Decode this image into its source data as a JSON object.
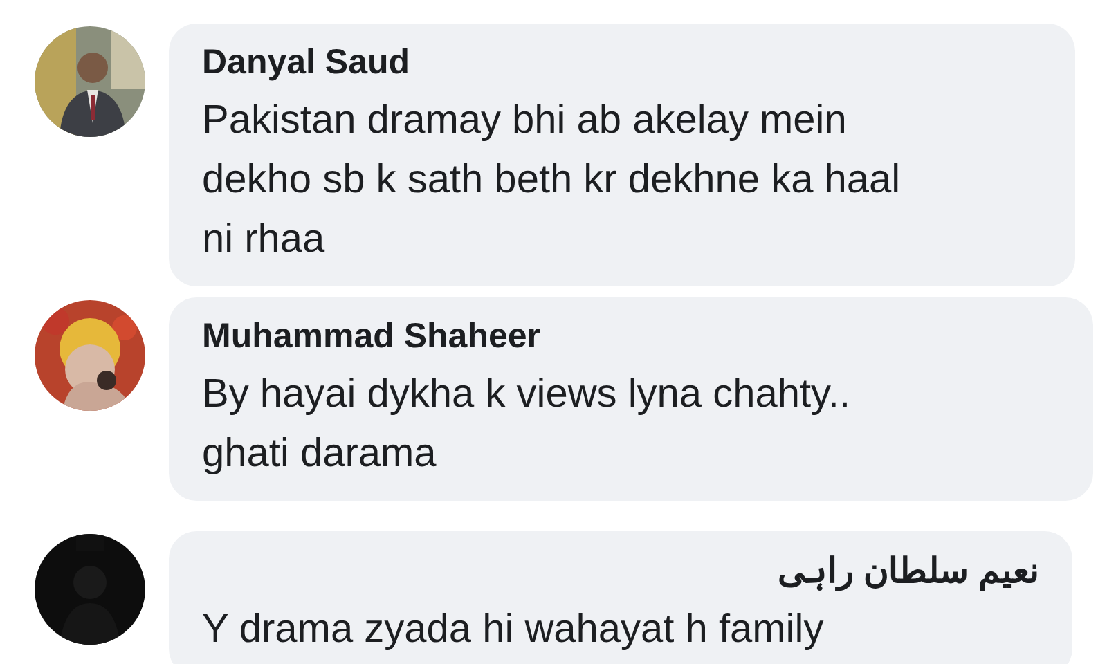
{
  "comments": [
    {
      "author": "Danyal Saud",
      "text": "Pakistan dramay bhi ab akelay mein\ndekho sb k sath beth kr dekhne ka haal\nni rhaa"
    },
    {
      "author": "Muhammad Shaheer",
      "text": "By hayai dykha k views lyna chahty..\nghati darama"
    },
    {
      "author": "نعیم سلطان راہی",
      "text": "Y drama zyada hi wahayat h family"
    }
  ]
}
